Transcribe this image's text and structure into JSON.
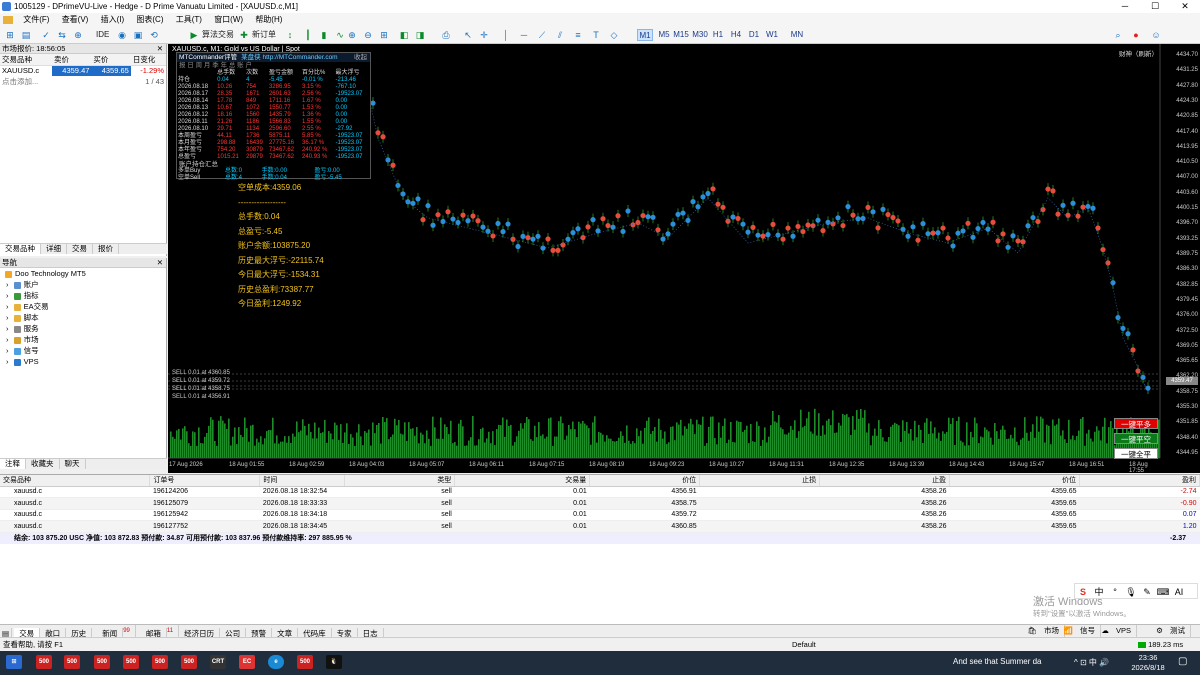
{
  "window": {
    "title": "1005129 - DPrimeVU-Live - Hedge - D Prime Vanuatu Limited - [XAUUSD.c,M1]"
  },
  "menu": [
    "文件(F)",
    "查看(V)",
    "插入(I)",
    "图表(C)",
    "工具(T)",
    "窗口(W)",
    "帮助(H)"
  ],
  "toolbar": {
    "ide": "IDE",
    "algo": "算法交易",
    "new_order": "新订单",
    "timeframes": [
      "M1",
      "M5",
      "M15",
      "M30",
      "H1",
      "H4",
      "D1",
      "W1",
      "MN"
    ],
    "active_tf": "M1"
  },
  "market_watch": {
    "title": "市场报价: 18:56:05",
    "headers": [
      "交易品种",
      "卖价",
      "买价",
      "日变化"
    ],
    "symbol": "XAUUSD.c",
    "bid": "4359.47",
    "ask": "4359.65",
    "change": "-1.29%",
    "add": "点击添加...",
    "count": "1 / 43",
    "tabs": [
      "交易品种",
      "详细",
      "交易",
      "报价"
    ]
  },
  "navigator": {
    "title": "导航",
    "root": "Doo Technology MT5",
    "items": [
      "账户",
      "指标",
      "EA交易",
      "脚本",
      "服务",
      "市场",
      "信号",
      "VPS"
    ],
    "tabs": [
      "注释",
      "收藏夹",
      "聊天"
    ]
  },
  "chart": {
    "title": "XAUUSD.c, M1: Gold vs US Dollar | Spot",
    "trade_label": "财神（刷新）",
    "panel": {
      "name": "MTCommander评管",
      "link": "某盘侠 http://MTCommander.com",
      "collapse": "收起",
      "menu": "报 日 周 月 季 年 总 账 户",
      "headers": [
        "",
        "总手数",
        "次数",
        "盈亏金额",
        "百分比%",
        "最大浮亏"
      ],
      "rows": [
        [
          "持仓",
          "0.04",
          "4",
          "-5.45",
          "-0.01 %",
          "-213.46"
        ],
        [
          "2026.08.18",
          "10.26",
          "754",
          "3286.95",
          "3.15 %",
          "-767.10"
        ],
        [
          "2026.08.17",
          "28.35",
          "1671",
          "2601.63",
          "2.56 %",
          "-19523.07"
        ],
        [
          "2026.08.14",
          "17.78",
          "849",
          "1711.16",
          "1.67 %",
          "0.00"
        ],
        [
          "2026.08.13",
          "10.67",
          "1072",
          "1550.77",
          "1.53 %",
          "0.00"
        ],
        [
          "2026.08.12",
          "18.16",
          "1560",
          "1435.79",
          "1.36 %",
          "0.00"
        ],
        [
          "2026.08.11",
          "21.26",
          "1186",
          "1566.83",
          "1.55 %",
          "0.00"
        ],
        [
          "2026.08.10",
          "29.71",
          "1134",
          "2596.60",
          "2.55 %",
          "-27.92"
        ],
        [
          "本周盈亏",
          "44.11",
          "1736",
          "5875.11",
          "5.85 %",
          "-19523.07"
        ],
        [
          "本月盈亏",
          "298.88",
          "16439",
          "27775.16",
          "36.17 %",
          "-19523.07"
        ],
        [
          "本年盈亏",
          "754.20",
          "30879",
          "73467.62",
          "240.92 %",
          "-19523.07"
        ],
        [
          "总盈亏",
          "1015.21",
          "29879",
          "73467.62",
          "240.93 %",
          "-19523.07"
        ]
      ],
      "account": "账户持仓汇总",
      "foot": [
        [
          "多单Buy",
          "总数:0",
          "手数:0.00",
          "盈亏:0.00"
        ],
        [
          "空单Sell",
          "总数:4",
          "手数:0.04",
          "盈亏:-5.45"
        ]
      ]
    },
    "stats": [
      "空单成本:4359.06",
      "------------------",
      "总手数:0.04",
      "总盈亏:-5.45",
      "账户余额:103875.20",
      "历史最大浮亏:-22115.74",
      "今日最大浮亏:-1534.31",
      "历史总盈利:73387.77",
      "今日盈利:1249.92"
    ],
    "price_axis": [
      "4434.70",
      "4431.25",
      "4427.80",
      "4424.30",
      "4420.85",
      "4417.40",
      "4413.95",
      "4410.50",
      "4407.00",
      "4403.60",
      "4400.15",
      "4396.70",
      "4393.25",
      "4389.75",
      "4386.30",
      "4382.85",
      "4379.45",
      "4376.00",
      "4372.50",
      "4369.05",
      "4365.65",
      "4362.20",
      "4358.75",
      "4355.30",
      "4351.85",
      "4348.40",
      "4344.95"
    ],
    "time_axis": [
      "17 Aug 2026",
      "18 Aug 01:55",
      "18 Aug 02:59",
      "18 Aug 04:03",
      "18 Aug 05:07",
      "18 Aug 06:11",
      "18 Aug 07:15",
      "18 Aug 08:19",
      "18 Aug 09:23",
      "18 Aug 10:27",
      "18 Aug 11:31",
      "18 Aug 12:35",
      "18 Aug 13:39",
      "18 Aug 14:43",
      "18 Aug 15:47",
      "18 Aug 16:51",
      "18 Aug 17:55"
    ],
    "sell_lines": [
      "SELL 0.01 at 4360.85",
      "SELL 0.01 at 4359.72",
      "SELL 0.01 at 4358.75",
      "SELL 0.01 at 4356.91"
    ],
    "current_price": "4359.47",
    "buttons": {
      "close_buy": "一键平多",
      "close_sell": "一键平空",
      "close_all": "一键全平"
    }
  },
  "trades": {
    "headers": [
      "交易品种",
      "订单号",
      "时间",
      "类型",
      "交易量",
      "价位",
      "止损",
      "止盈",
      "价位",
      "盈利"
    ],
    "rows": [
      [
        "xauusd.c",
        "196124206",
        "2026.08.18 18:32:54",
        "sell",
        "0.01",
        "4356.91",
        "",
        "4358.26",
        "4359.65",
        "-2.74"
      ],
      [
        "xauusd.c",
        "196125079",
        "2026.08.18 18:33:33",
        "sell",
        "0.01",
        "4358.75",
        "",
        "4358.26",
        "4359.65",
        "-0.90"
      ],
      [
        "xauusd.c",
        "196125942",
        "2026.08.18 18:34:18",
        "sell",
        "0.01",
        "4359.72",
        "",
        "4358.26",
        "4359.65",
        "0.07"
      ],
      [
        "xauusd.c",
        "196127752",
        "2026.08.18 18:34:45",
        "sell",
        "0.01",
        "4360.85",
        "",
        "4358.26",
        "4359.65",
        "1.20"
      ]
    ],
    "balance": "结余: 103 875.20 USC  净值: 103 872.83  预付款: 34.87  可用预付款: 103 837.96  预付款维持率: 297 885.95 %",
    "total": "-2.37"
  },
  "terminal_tabs": [
    "交易",
    "敞口",
    "历史",
    "新闻",
    "邮箱",
    "经济日历",
    "公司",
    "预警",
    "文章",
    "代码库",
    "专家",
    "日志"
  ],
  "badges": {
    "news": "99",
    "mail": "11"
  },
  "statusbar": {
    "help": "查看帮助, 请按 F1",
    "profile": "Default",
    "right_items": [
      "市场",
      "信号",
      "VPS",
      "测试"
    ],
    "ping": "189.23 ms"
  },
  "taskbar": {
    "song": "And see that Summer da",
    "time": "23:36",
    "date": "2026/8/18"
  },
  "watermark": {
    "line1": "激活 Windows",
    "line2": "转到\"设置\"以激活 Windows。"
  },
  "ime": [
    "中",
    "AI"
  ],
  "colors": {
    "bull": "#e84c3d",
    "bear": "#2b8fd9",
    "volume": "#1f8c2a",
    "bg": "#000000"
  }
}
